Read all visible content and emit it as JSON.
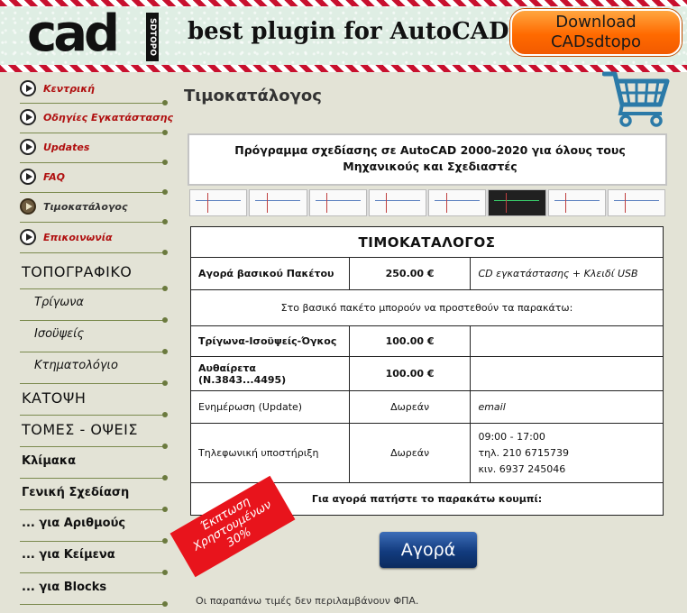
{
  "header": {
    "logo_text": "cad",
    "logo_sub": "SDTOPO",
    "slogan": "best plugin for AutoCAD",
    "download_line1": "Download",
    "download_line2": "CADsdtopo"
  },
  "sidebar": {
    "nav": [
      {
        "label": "Κεντρική",
        "active": false
      },
      {
        "label": "Οδηγίες Εγκατάστασης",
        "active": false
      },
      {
        "label": "Updates",
        "active": false
      },
      {
        "label": "FAQ",
        "active": false
      },
      {
        "label": "Τιμοκατάλογος",
        "active": true
      },
      {
        "label": "Επικοινωνία",
        "active": false
      }
    ],
    "menu": [
      {
        "label": "ΤΟΠΟΓΡΑΦΙΚΟ",
        "style": "big"
      },
      {
        "label": "Τρίγωνα",
        "style": "sub"
      },
      {
        "label": "Ισοϋψείς",
        "style": "sub"
      },
      {
        "label": "Κτηματολόγιο",
        "style": "sub"
      },
      {
        "label": "ΚΑΤΟΨΗ",
        "style": "big"
      },
      {
        "label": "ΤΟΜΕΣ - ΟΨΕΙΣ",
        "style": "big"
      },
      {
        "label": "Κλίμακα",
        "style": "bold"
      },
      {
        "label": "Γενική Σχεδίαση",
        "style": "bold"
      },
      {
        "label": "... για Αριθμούς",
        "style": "bold"
      },
      {
        "label": "... για Κείμενα",
        "style": "bold"
      },
      {
        "label": "... για Blocks",
        "style": "bold"
      }
    ]
  },
  "main": {
    "title": "Τιμοκατάλογος",
    "intro": "Πρόγραμμα σχεδίασης σε AutoCAD 2000-2020 για όλους τους Μηχανικούς και Σχεδιαστές",
    "table_title": "ΤΙΜΟΚΑΤΑΛΟΓΟΣ",
    "rows": {
      "basic_name": "Αγορά βασικού Πακέτου",
      "basic_price": "250.00 €",
      "basic_note": "CD εγκατάστασης + Κλειδί USB",
      "addons_note": "Στο βασικό πακέτο μπορούν να προστεθούν τα παρακάτω:",
      "addon1_name": "Τρίγωνα-Ισοϋψείς-Όγκος",
      "addon1_price": "100.00 €",
      "addon2_name": "Αυθαίρετα (Ν.3843...4495)",
      "addon2_price": "100.00 €",
      "update_name": "Ενημέρωση (Update)",
      "update_price": "Δωρεάν",
      "update_note": "email",
      "support_name": "Τηλεφωνική υποστήριξη",
      "support_price": "Δωρεάν",
      "support_hours": "09:00 - 17:00",
      "support_phone": "τηλ.  210 6715739",
      "support_mobile": "κιν.   6937 245046",
      "buy_hint": "Για αγορά πατήστε το παρακάτω κουμπί:"
    },
    "badge_line1": "Έκπτωση",
    "badge_line2": "Χρηστουμένων",
    "badge_line3": "30%",
    "buy_button": "Αγορά",
    "vat_note": "Οι παραπάνω τιμές δεν περιλαμβάνουν ΦΠΑ."
  },
  "colors": {
    "background": "#e3e3d6",
    "nav_red": "#b01010",
    "download_orange": "#ff6a00",
    "buy_blue": "#123b7e",
    "badge_red": "#e8141c"
  }
}
